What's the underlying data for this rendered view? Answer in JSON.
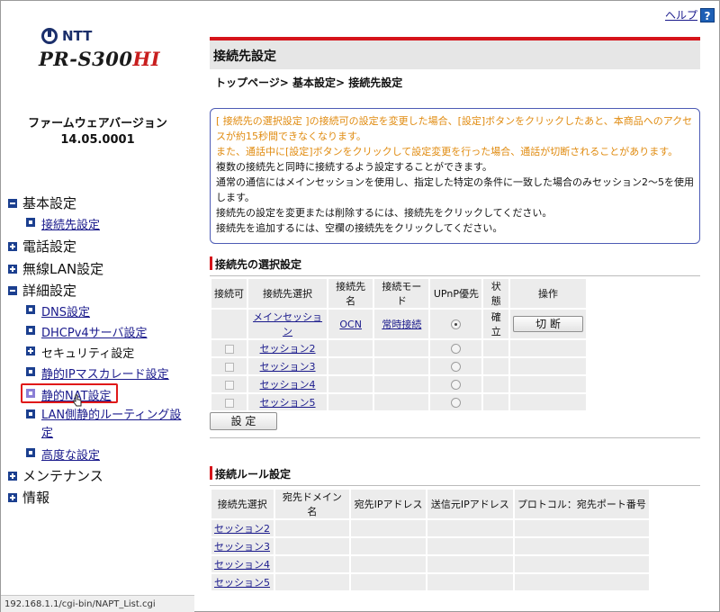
{
  "brand": {
    "maker": "NTT",
    "model_main": "PR-S300",
    "model_suffix": "HI"
  },
  "firmware": {
    "label": "ファームウェアバージョン",
    "version": "14.05.0001"
  },
  "help": {
    "label": "ヘルプ",
    "icon": "?"
  },
  "nav": {
    "basic": "基本設定",
    "connection": "接続先設定",
    "phone": "電話設定",
    "wlan": "無線LAN設定",
    "advanced": "詳細設定",
    "dns": "DNS設定",
    "dhcp": "DHCPv4サーバ設定",
    "security": "セキュリティ設定",
    "static_ip": "静的IPマスカレード設定",
    "static_nat": "静的NAT設定",
    "lan_routing_1": "LAN側静的ルーティング設",
    "lan_routing_2": "定",
    "adv_settings": "高度な設定",
    "maintenance": "メンテナンス",
    "info": "情報"
  },
  "status_url": "192.168.1.1/cgi-bin/NAPT_List.cgi",
  "page": {
    "title": "接続先設定",
    "breadcrumb": "トップページ> 基本設定> 接続先設定"
  },
  "notice": {
    "warn1": "[ 接続先の選択設定 ]の接続可の設定を変更した場合、[設定]ボタンをクリックしたあと、本商品へのアクセスが約15秒間できなくなります。",
    "warn2": "また、通話中に[設定]ボタンをクリックして設定変更を行った場合、通話が切断されることがあります。",
    "line1": "複数の接続先と同時に接続するよう設定することができます。",
    "line2": "通常の通信にはメインセッションを使用し、指定した特定の条件に一致した場合のみセッション2～5を使用します。",
    "line3": "接続先の設定を変更または削除するには、接続先をクリックしてください。",
    "line4": "接続先を追加するには、空欄の接続先をクリックしてください。"
  },
  "select_section": {
    "title": "接続先の選択設定",
    "headers": [
      "接続可",
      "接続先選択",
      "接続先名",
      "接続モード",
      "UPnP優先",
      "状態",
      "操作"
    ],
    "rows": [
      {
        "session": "メインセッション",
        "name": "OCN",
        "mode": "常時接続",
        "upnp": true,
        "state": "確立",
        "action": "切 断"
      },
      {
        "session": "セッション2",
        "name": "",
        "mode": "",
        "upnp": false,
        "state": "",
        "action": ""
      },
      {
        "session": "セッション3",
        "name": "",
        "mode": "",
        "upnp": false,
        "state": "",
        "action": ""
      },
      {
        "session": "セッション4",
        "name": "",
        "mode": "",
        "upnp": false,
        "state": "",
        "action": ""
      },
      {
        "session": "セッション5",
        "name": "",
        "mode": "",
        "upnp": false,
        "state": "",
        "action": ""
      }
    ],
    "set_button": "設 定"
  },
  "rule_section": {
    "title": "接続ルール設定",
    "headers": [
      "接続先選択",
      "宛先ドメイン名",
      "宛先IPアドレス",
      "送信元IPアドレス",
      "プロトコル：宛先ポート番号"
    ],
    "rows": [
      "セッション2",
      "セッション3",
      "セッション4",
      "セッション5"
    ]
  },
  "colors": {
    "accent_red": "#d6141a",
    "nav_blue": "#1b3f8f",
    "warn_orange": "#e08b10",
    "link": "#1a1a8c"
  }
}
